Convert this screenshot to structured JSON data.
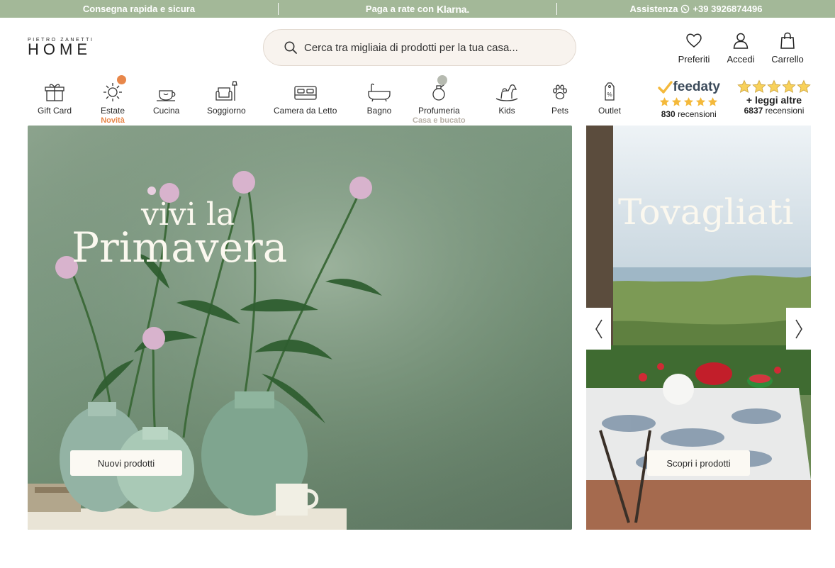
{
  "topbar": {
    "shipping": "Consegna rapida e sicura",
    "installments_prefix": "Paga a rate con",
    "installments_brand": "Klarna.",
    "support_label": "Assistenza",
    "support_phone": "+39 3926874496"
  },
  "logo": {
    "small": "PIETRO ZANETTI",
    "big": "HOME"
  },
  "search": {
    "placeholder": "Cerca tra migliaia di prodotti per la tua casa..."
  },
  "header_actions": [
    {
      "label": "Preferiti",
      "icon": "heart-icon"
    },
    {
      "label": "Accedi",
      "icon": "user-icon"
    },
    {
      "label": "Carrello",
      "icon": "cart-bag-icon"
    }
  ],
  "categories": [
    {
      "label": "Gift Card",
      "sub": "",
      "icon": "gift-icon"
    },
    {
      "label": "Estate",
      "sub": "Novità",
      "icon": "sun-icon"
    },
    {
      "label": "Cucina",
      "sub": "",
      "icon": "teapot-icon"
    },
    {
      "label": "Soggiorno",
      "sub": "",
      "icon": "armchair-lamp-icon"
    },
    {
      "label": "Camera da Letto",
      "sub": "",
      "icon": "bed-icon"
    },
    {
      "label": "Bagno",
      "sub": "",
      "icon": "bathtub-icon"
    },
    {
      "label": "Profumeria",
      "sub": "Casa e bucato",
      "icon": "perfume-bottle-icon"
    },
    {
      "label": "Kids",
      "sub": "",
      "icon": "rocking-horse-icon"
    },
    {
      "label": "Pets",
      "sub": "",
      "icon": "paw-icon"
    },
    {
      "label": "Outlet",
      "sub": "",
      "icon": "price-tag-icon"
    }
  ],
  "reviews": {
    "feedaty_brand": "feedaty",
    "feedaty_count": "830",
    "feedaty_suffix": "recensioni",
    "more_label": "+ leggi altre",
    "other_count": "6837",
    "other_suffix": "recensioni"
  },
  "banners": {
    "main": {
      "title_line1": "vivi la",
      "title_line2": "Primavera",
      "cta": "Nuovi prodotti"
    },
    "side": {
      "title": "Tovagliati",
      "cta": "Scopri i prodotti"
    }
  },
  "colors": {
    "topbar_bg": "#a3b898",
    "accent_orange": "#e8874a",
    "sub_gray": "#b8b1a8",
    "star_gold": "#f4b93b"
  }
}
